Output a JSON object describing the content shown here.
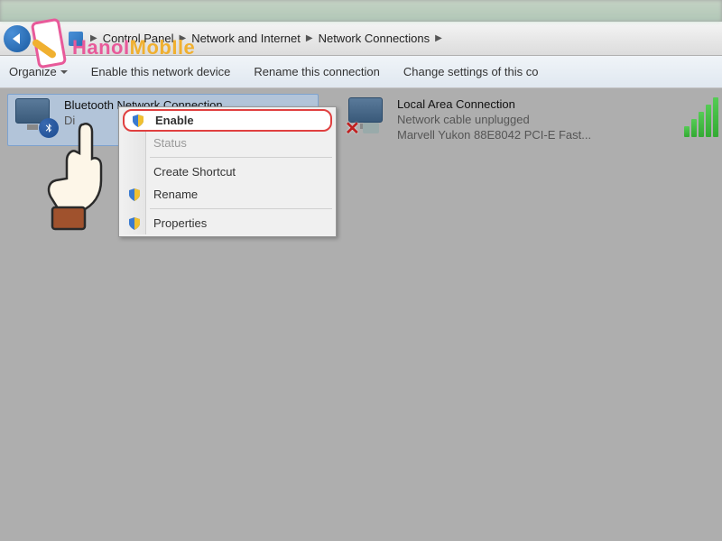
{
  "breadcrumb": {
    "items": [
      "Control Panel",
      "Network and Internet",
      "Network Connections"
    ]
  },
  "toolbar": {
    "organize": "Organize",
    "enable_device": "Enable this network device",
    "rename_conn": "Rename this connection",
    "change_settings": "Change settings of this co"
  },
  "connections": [
    {
      "name": "Bluetooth Network Connection",
      "status": "Di",
      "device": ""
    },
    {
      "name": "Local Area Connection",
      "status": "Network cable unplugged",
      "device": "Marvell Yukon 88E8042 PCI-E Fast..."
    }
  ],
  "context_menu": {
    "enable": "Enable",
    "status": "Status",
    "create_shortcut": "Create Shortcut",
    "rename": "Rename",
    "properties": "Properties"
  },
  "watermark": {
    "text_a": "HanoI",
    "text_b": "MobIle"
  },
  "icons": {
    "bluetooth_glyph": "⌖"
  }
}
